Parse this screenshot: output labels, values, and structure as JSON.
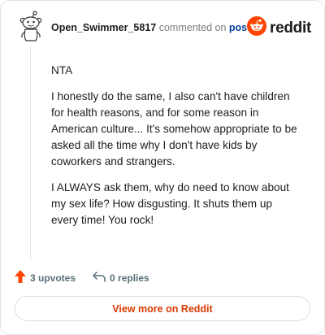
{
  "comment": {
    "username": "Open_Swimmer_5817",
    "action_text": "commented on",
    "post_link_label": "post",
    "paragraphs": [
      "NTA",
      "I honestly do the same, I also can't have children for health reasons, and for some reason in American culture... It's somehow appropriate to be asked all the time why I don't have kids by coworkers and strangers.",
      "I ALWAYS ask them, why do need to know about my sex life? How disgusting. It shuts them up every time! You rock!"
    ]
  },
  "brand": {
    "wordmark": "reddit",
    "color": "#ff4500"
  },
  "actions": {
    "upvotes_label": "3 upvotes",
    "replies_label": "0 replies",
    "upvote_color": "#ff4500"
  },
  "footer": {
    "view_more_label": "View more on Reddit"
  },
  "icons": {
    "avatar": "snoo-avatar-icon",
    "brand": "reddit-logo-icon",
    "upvote": "upvote-arrow-icon",
    "reply": "reply-arrow-icon"
  }
}
